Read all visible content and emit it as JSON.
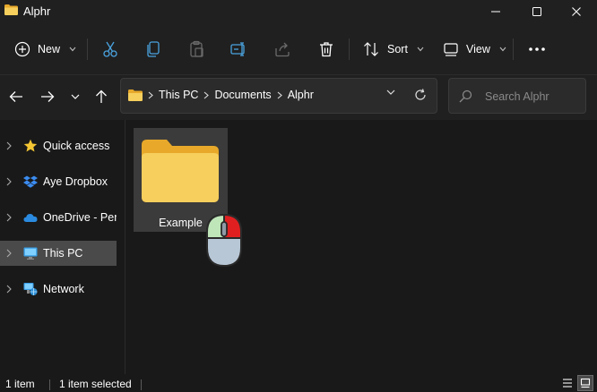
{
  "window": {
    "title": "Alphr"
  },
  "toolbar": {
    "new_label": "New",
    "sort_label": "Sort",
    "view_label": "View",
    "icons": [
      "plus-circle-icon",
      "cut-icon",
      "copy-icon",
      "paste-icon",
      "rename-icon",
      "share-icon",
      "delete-icon",
      "sort-icon",
      "view-icon",
      "more-icon"
    ]
  },
  "address": {
    "crumbs": [
      "This PC",
      "Documents",
      "Alphr"
    ]
  },
  "search": {
    "placeholder": "Search Alphr"
  },
  "sidebar": {
    "items": [
      {
        "label": "Quick access",
        "icon": "star-icon"
      },
      {
        "label": "Aye Dropbox",
        "icon": "dropbox-icon"
      },
      {
        "label": "OneDrive - Pers",
        "icon": "onedrive-cloud-icon"
      },
      {
        "label": "This PC",
        "icon": "monitor-icon",
        "selected": true
      },
      {
        "label": "Network",
        "icon": "network-icon"
      }
    ]
  },
  "content": {
    "items": [
      {
        "name": "Example",
        "type": "folder",
        "selected": true
      }
    ]
  },
  "status": {
    "item_count": "1 item",
    "selection": "1 item selected"
  },
  "colors": {
    "folder_front": "#f6cf5d",
    "folder_back": "#e8a92a",
    "accent_blue": "#4aa3df",
    "selected_bg": "#4a4a4a"
  }
}
